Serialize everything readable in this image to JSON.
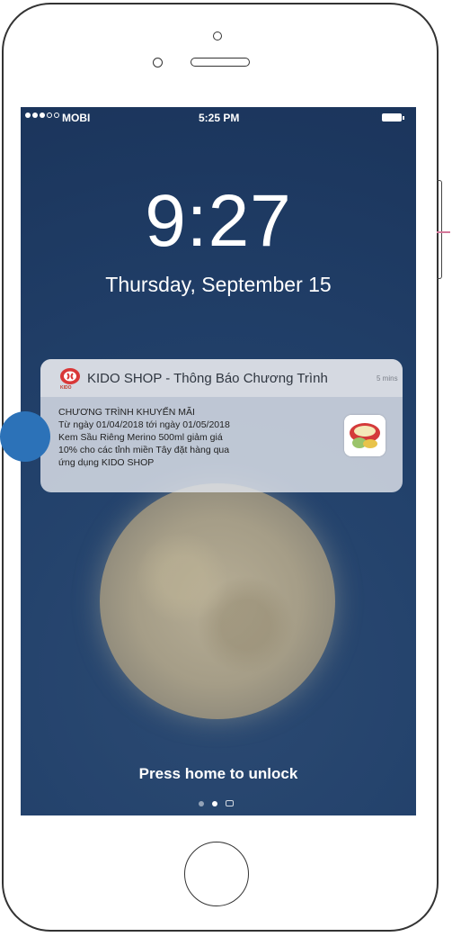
{
  "status_bar": {
    "carrier": "MOBI",
    "time": "5:25 PM"
  },
  "lock_screen": {
    "clock": "9:27",
    "date": "Thursday, September 15",
    "unlock_hint": "Press home to unlock"
  },
  "notification": {
    "app_logo_text": "KIDO",
    "title": "KIDO SHOP - Thông Báo Chương Trình",
    "time": "5 mins",
    "lines": [
      "CHƯƠNG TRÌNH KHUYẾN MÃI",
      "Từ ngày  01/04/2018 tới ngày 01/05/2018",
      "Kem Sầu Riêng Merino 500ml giảm giá",
      "10% cho các tỉnh miền  Tây đặt hàng qua",
      "ứng dụng KIDO SHOP"
    ],
    "thumbnail_icon": "ice-cream-product-icon"
  },
  "colors": {
    "wallpaper": "#22416b",
    "marker": "#2c72b8",
    "accent_line": "#d4789a"
  }
}
